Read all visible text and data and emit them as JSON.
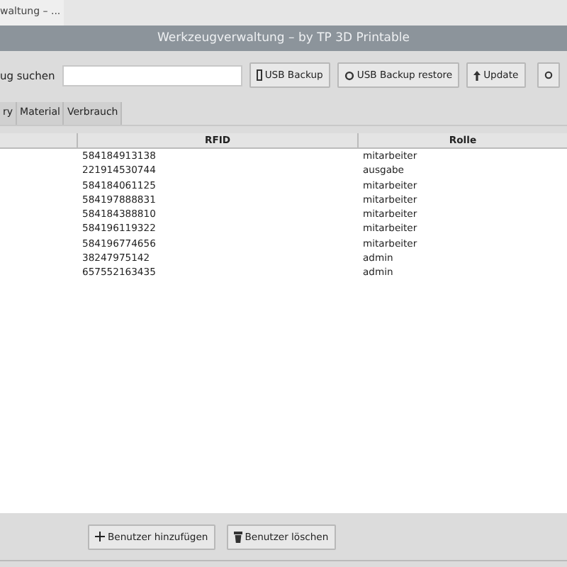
{
  "taskbar_tab": {
    "title": "waltung – ..."
  },
  "window": {
    "title": "Werkzeugverwaltung – by TP 3D Printable"
  },
  "toolbar": {
    "search_label": "ug suchen",
    "buttons": [
      {
        "label": "USB Backup",
        "kind": "usb"
      },
      {
        "label": "USB Backup restore",
        "kind": "restore"
      },
      {
        "label": "Update",
        "kind": "update"
      },
      {
        "kind": "settings"
      }
    ]
  },
  "tabs": [
    {
      "label": "ry",
      "selected": false
    },
    {
      "label": "Material",
      "selected": false
    },
    {
      "label": "Verbrauch",
      "selected": false
    }
  ],
  "table": {
    "columns": [
      "RFID",
      "Rolle"
    ],
    "rows": [
      [
        "584184913138",
        "mitarbeiter"
      ],
      [
        "221914530744",
        "ausgabe"
      ],
      [
        "584184061125",
        "mitarbeiter"
      ],
      [
        "584197888831",
        "mitarbeiter"
      ],
      [
        "584184388810",
        "mitarbeiter"
      ],
      [
        "584196119322",
        "mitarbeiter"
      ],
      [
        "584196774656",
        "mitarbeiter"
      ],
      [
        "38247975142",
        "admin"
      ],
      [
        "657552163435",
        "admin"
      ]
    ]
  },
  "footer_buttons": [
    {
      "label": "Benutzer hinzufügen",
      "kind": "add"
    },
    {
      "label": "Benutzer löschen",
      "kind": "delete"
    }
  ]
}
